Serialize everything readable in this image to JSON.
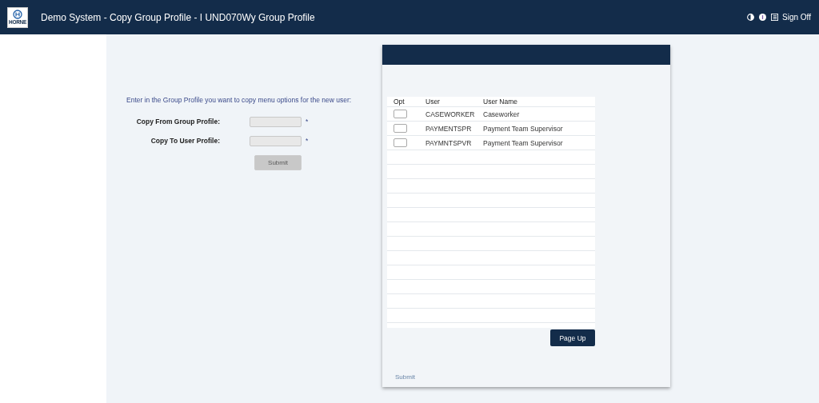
{
  "header": {
    "logo_text": "HORNE",
    "title": "Demo System - Copy Group Profile - I UND070Wy Group Profile",
    "sign_off": "Sign Off"
  },
  "form": {
    "instruction": "Enter in the Group Profile you want to copy menu options for the new user:",
    "fields": [
      {
        "label": "Copy From Group Profile:",
        "required_mark": "*"
      },
      {
        "label": "Copy To User Profile:",
        "required_mark": "*"
      }
    ],
    "submit": {
      "label": "Submit",
      "disabled": true
    }
  },
  "dialog": {
    "table": {
      "columns": [
        "Opt",
        "User",
        "User Name"
      ],
      "rows": [
        {
          "checked": false,
          "user": "CASEWORKER",
          "user_name": "Caseworker"
        },
        {
          "checked": false,
          "user": "PAYMENTSPR",
          "user_name": "Payment Team Supervisor"
        },
        {
          "checked": false,
          "user": "PAYMNTSPVR",
          "user_name": "Payment Team Supervisor"
        }
      ]
    },
    "page_up": "Page Up",
    "submit_link": "Submit"
  }
}
